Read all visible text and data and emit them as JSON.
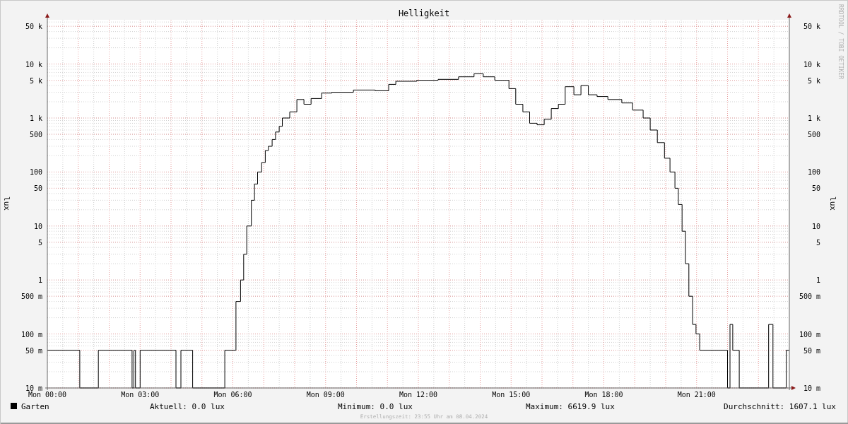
{
  "graph": {
    "title": "Helligkeit",
    "credit": "RRDTOOL / TOBI OETIKER",
    "left_axis": {
      "label": "lux",
      "ticks": [
        "50 k",
        "10 k",
        "5 k",
        "1 k",
        "500",
        "100",
        "50",
        "10",
        "5",
        "1",
        "500 m",
        "100 m",
        "50 m",
        "10 m"
      ]
    },
    "right_axis": {
      "label": "lux",
      "ticks": [
        "50 k",
        "10 k",
        "5 k",
        "1 k",
        "500",
        "100",
        "50",
        "10",
        "5",
        "1",
        "500 m",
        "100 m",
        "50 m",
        "10 m"
      ]
    },
    "x_axis": {
      "ticks": [
        "Mon 00:00",
        "Mon 03:00",
        "Mon 06:00",
        "Mon 09:00",
        "Mon 12:00",
        "Mon 15:00",
        "Mon 18:00",
        "Mon 21:00"
      ]
    },
    "series": {
      "name": "Garten",
      "color": "#000000"
    },
    "legend": [
      {
        "label": "Aktuell:",
        "value": "0.0 lux"
      },
      {
        "label": "Minimum:",
        "value": "0.0 lux"
      },
      {
        "label": "Maximum:",
        "value": "6619.9 lux"
      },
      {
        "label": "Durchschnitt:",
        "value": "1607.1 lux"
      }
    ],
    "footer": "Erstellungszeit: 23:55 Uhr am 08.04.2024"
  }
}
